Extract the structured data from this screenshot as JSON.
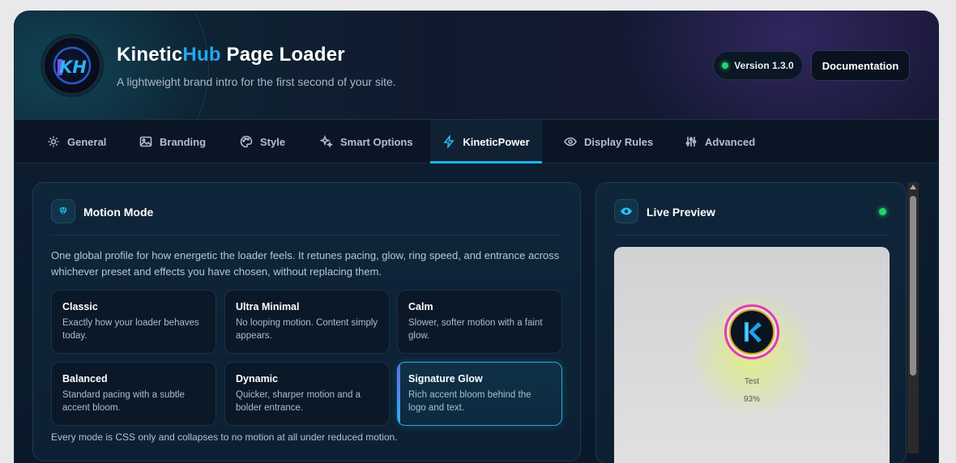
{
  "header": {
    "title_main": "Kinetic",
    "title_accent": "Hub",
    "title_rest": " Page Loader",
    "subtitle": "A lightweight brand intro for the first second of your site.",
    "version": "Version 1.3.0",
    "documentation": "Documentation",
    "logo_text": "KH"
  },
  "tabs": [
    {
      "label": "General",
      "icon": "gear-icon"
    },
    {
      "label": "Branding",
      "icon": "image-icon"
    },
    {
      "label": "Style",
      "icon": "palette-icon"
    },
    {
      "label": "Smart Options",
      "icon": "sparkles-icon"
    },
    {
      "label": "KineticPower",
      "icon": "lightning-icon",
      "active": true
    },
    {
      "label": "Display Rules",
      "icon": "eye-icon"
    },
    {
      "label": "Advanced",
      "icon": "sliders-icon"
    }
  ],
  "motion": {
    "title": "Motion Mode",
    "description": "One global profile for how energetic the loader feels. It retunes pacing, glow, ring speed, and entrance across whichever preset and effects you have chosen, without replacing them.",
    "modes": [
      {
        "name": "Classic",
        "desc": "Exactly how your loader behaves today."
      },
      {
        "name": "Ultra Minimal",
        "desc": "No looping motion. Content simply appears."
      },
      {
        "name": "Calm",
        "desc": "Slower, softer motion with a faint glow."
      },
      {
        "name": "Balanced",
        "desc": "Standard pacing with a subtle accent bloom."
      },
      {
        "name": "Dynamic",
        "desc": "Quicker, sharper motion and a bolder entrance."
      },
      {
        "name": "Signature Glow",
        "desc": "Rich accent bloom behind the logo and text.",
        "selected": true
      }
    ],
    "footnote": "Every mode is CSS only and collapses to no motion at all under reduced motion."
  },
  "preview": {
    "title": "Live Preview",
    "text": "Test",
    "progress": "93%",
    "colors": {
      "ring": "#e23ab8",
      "glow": "#e1f078"
    }
  },
  "colors": {
    "accent": "#1fb4ee",
    "status": "#22d36c"
  }
}
